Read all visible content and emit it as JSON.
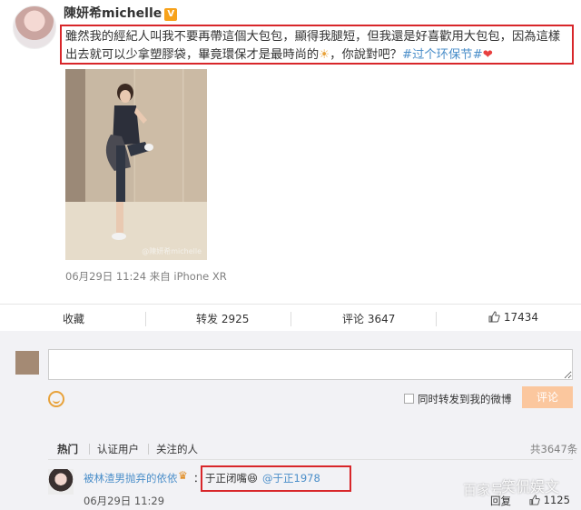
{
  "post": {
    "username": "陳妍希michelle",
    "verified_badge": "V",
    "text_main": "雖然我的經紀人叫我不要再帶這個大包包，顯得我腿短，但我還是好喜歡用大包包，因為這樣出去就可以少拿塑膠袋，畢竟環保才是最時尚的",
    "sun_emoji": "☀",
    "text_tail": "，你說對吧？",
    "topic": "#过个环保节#",
    "heart": "❤",
    "photo_watermark": "@陳妍希michelle",
    "meta": "06月29日 11:24  来自 iPhone XR"
  },
  "actions": {
    "favorite": "收藏",
    "repost": "转发 2925",
    "comment": "评论 3647",
    "like": "17434"
  },
  "comment_box": {
    "placeholder": "",
    "share_label": "同时转发到我的微博",
    "submit": "评论"
  },
  "tabs": {
    "hot": "热门",
    "verified": "认证用户",
    "following": "关注的人",
    "total": "共3647条"
  },
  "comment": {
    "name": "被林渣男抛弃的依依",
    "crown": "♛",
    "colon": "：",
    "text": "于正闭嘴😆",
    "mention": "@于正1978",
    "time": "06月29日 11:29",
    "reply": "回复",
    "like_count": "1125"
  },
  "watermarks": {
    "a": "百家号",
    "b": "笑侃娱文"
  },
  "colors": {
    "accent_blue": "#4a8ec9",
    "highlight_red": "#d8262a",
    "verified_orange": "#f7a21b",
    "comment_button": "#fbc79e"
  }
}
